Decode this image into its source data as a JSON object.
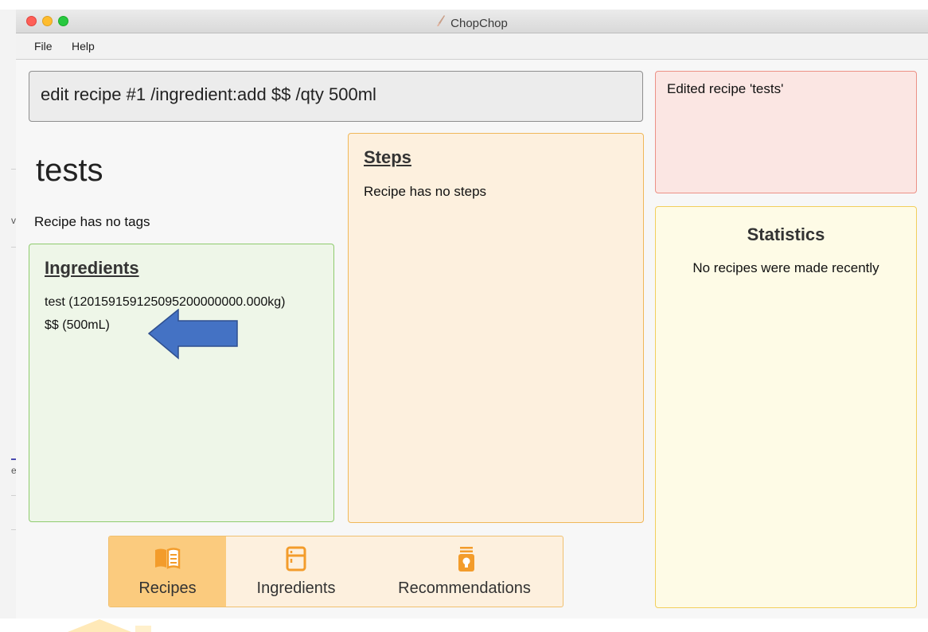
{
  "window": {
    "title": "ChopChop"
  },
  "menu": {
    "file": "File",
    "help": "Help"
  },
  "command": {
    "value": "edit recipe #1 /ingredient:add $$ /qty 500ml"
  },
  "recipe": {
    "name": "tests",
    "tags_text": "Recipe has no tags",
    "ingredients_heading": "Ingredients",
    "ingredients": [
      "test (120159159125095200000000.000kg)",
      "$$ (500mL)"
    ],
    "steps_heading": "Steps",
    "steps_text": "Recipe has no steps"
  },
  "result": {
    "message": "Edited recipe 'tests'"
  },
  "statistics": {
    "title": "Statistics",
    "empty_text": "No recipes were made recently"
  },
  "tabs": [
    {
      "label": "Recipes",
      "icon": "book-icon",
      "active": true
    },
    {
      "label": "Ingredients",
      "icon": "fridge-icon",
      "active": false
    },
    {
      "label": "Recommendations",
      "icon": "lightbulb-jar-icon",
      "active": false
    }
  ],
  "colors": {
    "accent_orange": "#f39c2b",
    "arrow_blue": "#4472c4",
    "ingredients_border": "#8fcb6e",
    "steps_border": "#f0b85a",
    "result_border": "#ec9186",
    "stats_border": "#f2cf5c"
  }
}
